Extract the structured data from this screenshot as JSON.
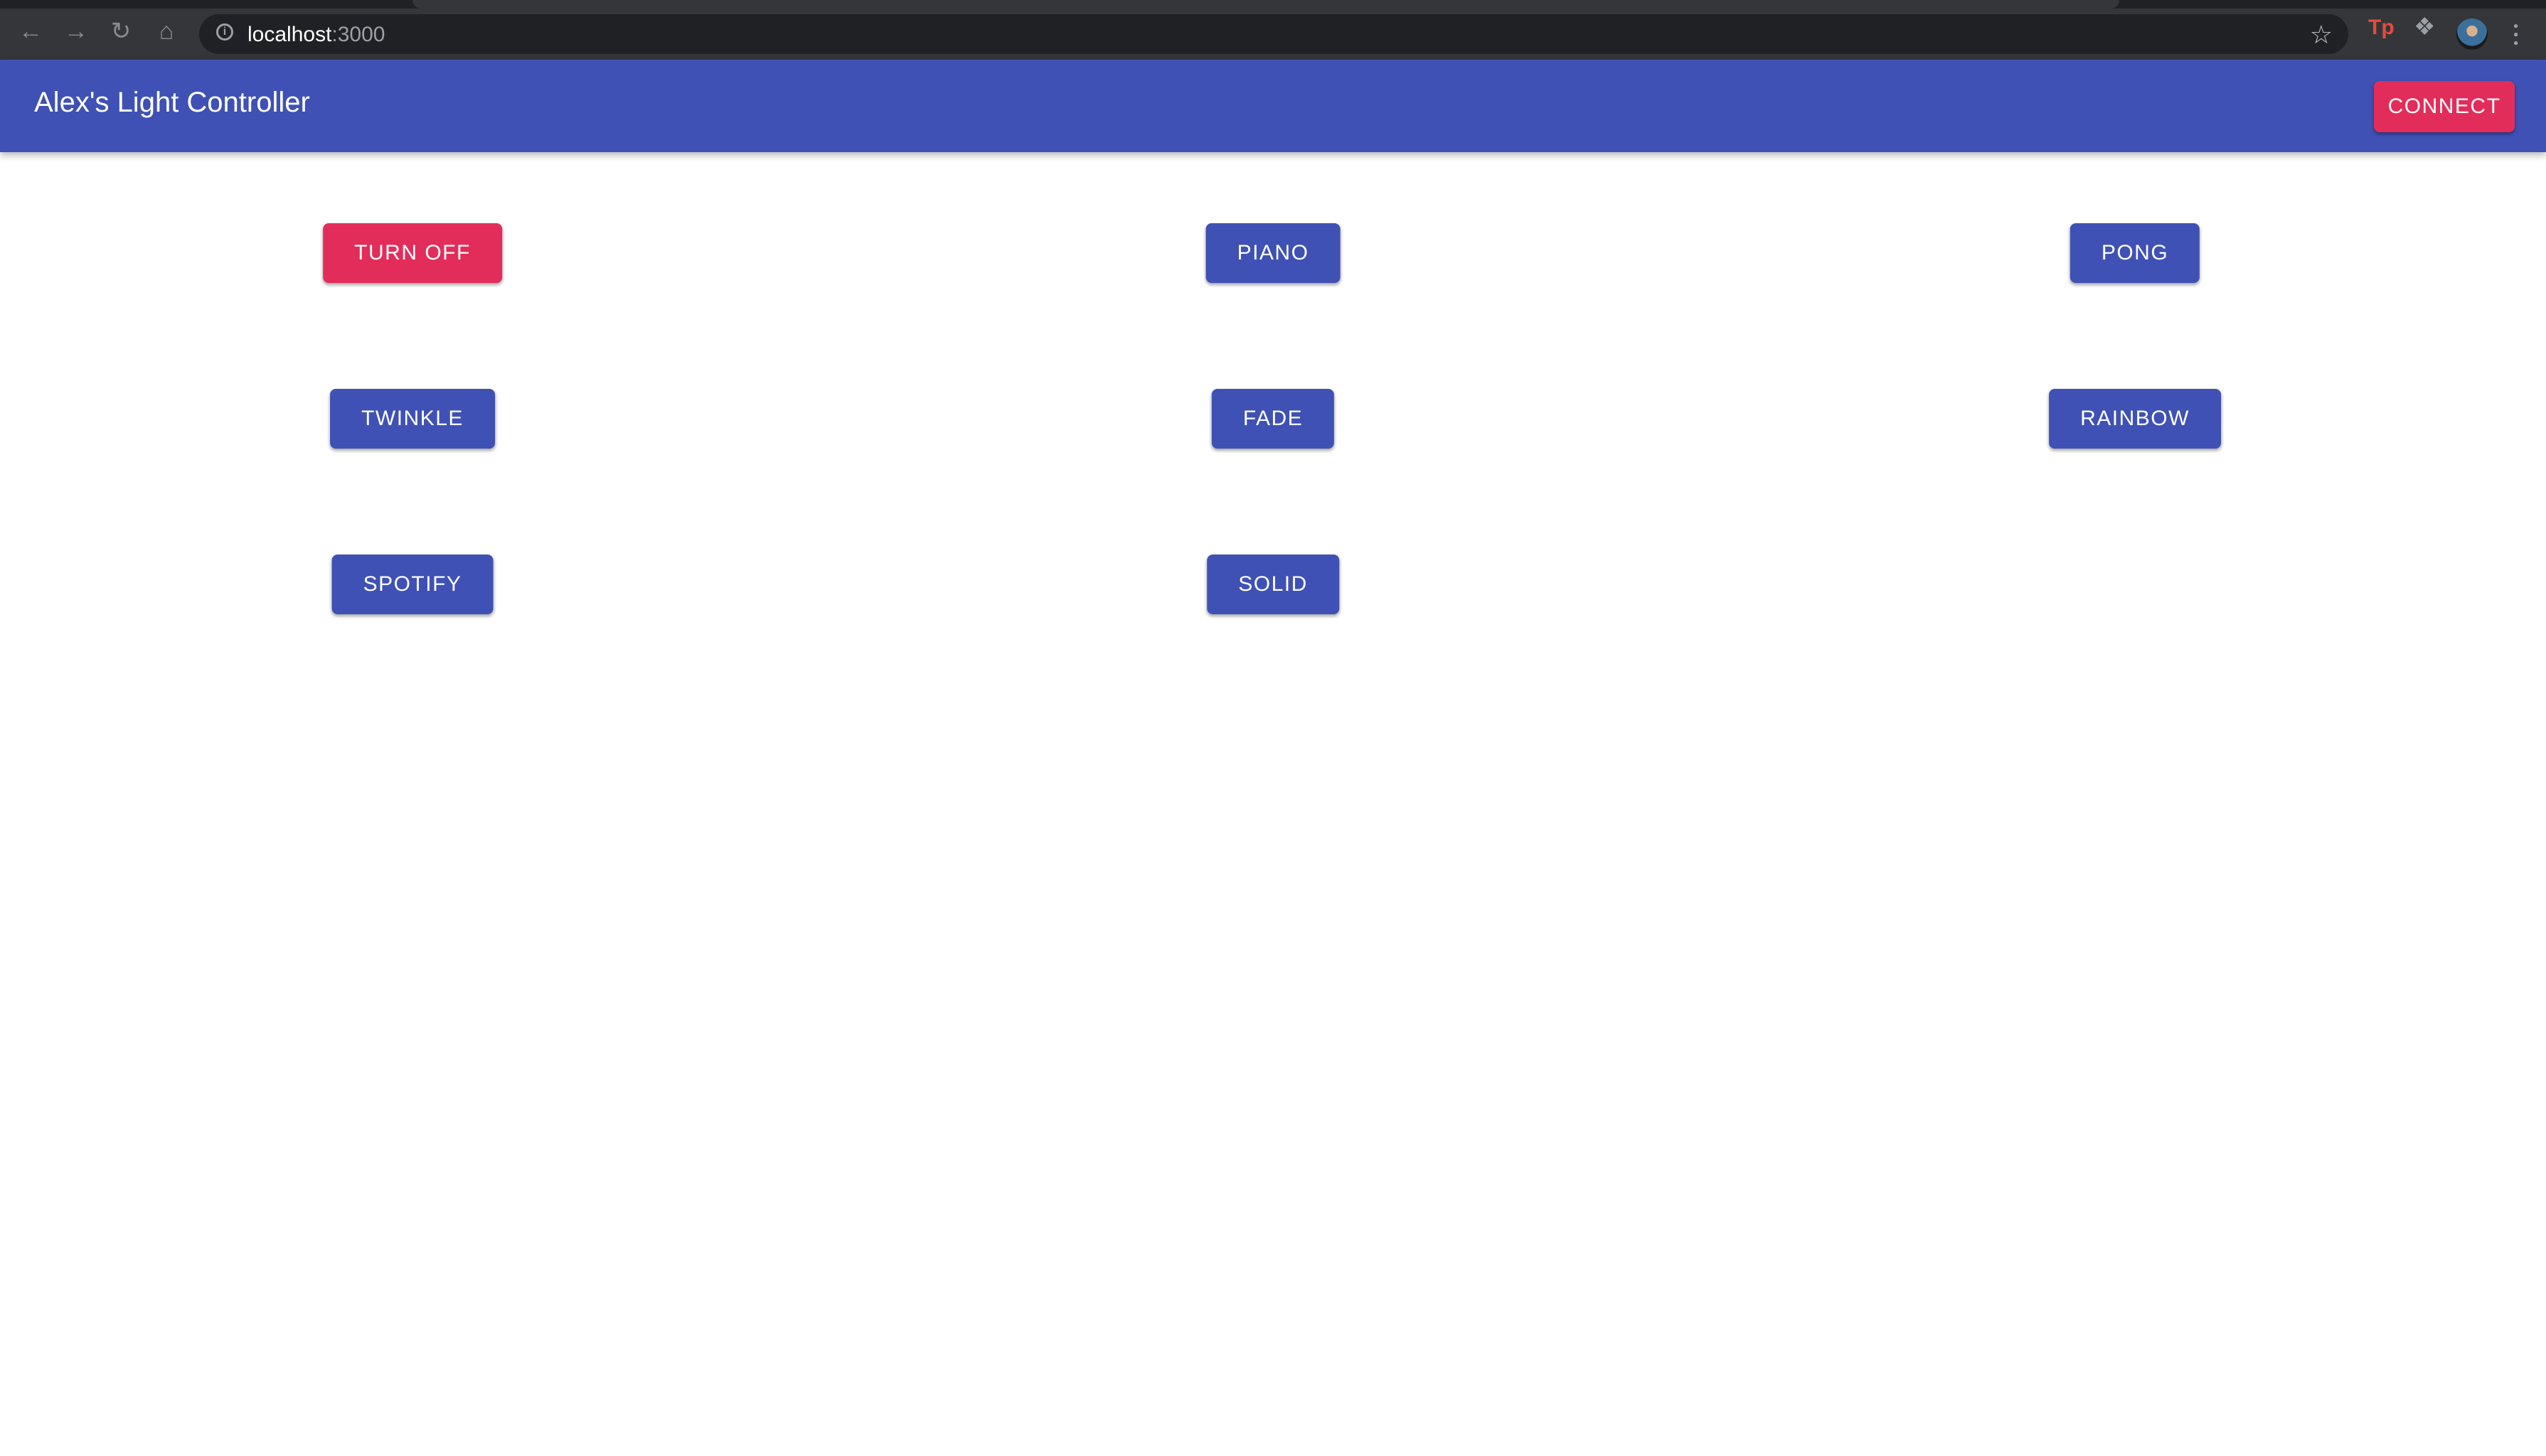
{
  "browser": {
    "url_host": "localhost",
    "url_port": ":3000",
    "icons": [
      "back-icon",
      "forward-icon",
      "reload-icon",
      "home-icon",
      "info-icon",
      "star-icon",
      "extension-tp-icon",
      "extensions-puzzle-icon",
      "profile-avatar",
      "more-menu-icon"
    ],
    "ext_label": "Tp"
  },
  "appbar": {
    "title": "Alex's Light Controller",
    "connect_label": "CONNECT",
    "colors": {
      "primary": "#3f51b5",
      "secondary": "#e22d5b"
    }
  },
  "buttons": [
    {
      "label": "TURN OFF",
      "variant": "secondary"
    },
    {
      "label": "PIANO",
      "variant": "primary"
    },
    {
      "label": "PONG",
      "variant": "primary"
    },
    {
      "label": "TWINKLE",
      "variant": "primary"
    },
    {
      "label": "FADE",
      "variant": "primary"
    },
    {
      "label": "RAINBOW",
      "variant": "primary"
    },
    {
      "label": "SPOTIFY",
      "variant": "primary"
    },
    {
      "label": "SOLID",
      "variant": "primary"
    }
  ]
}
